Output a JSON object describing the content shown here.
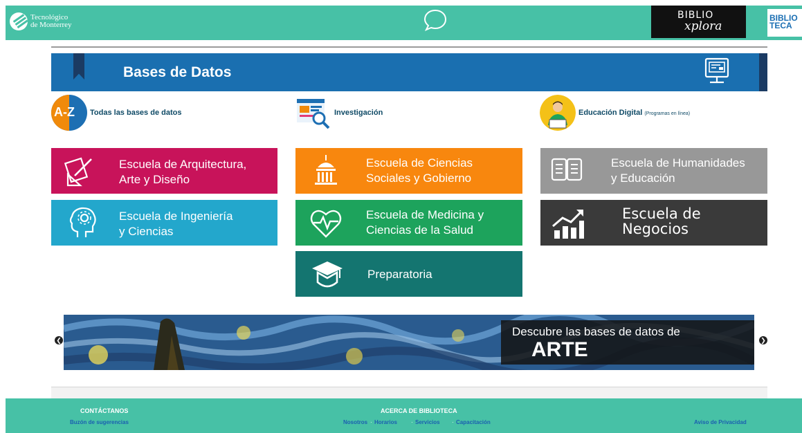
{
  "header": {
    "logo_line1": "Tecnológico",
    "logo_line2": "de Monterrey",
    "biblioxplora_top": "BIBLIO",
    "biblioxplora_bottom": "xplora",
    "biblioteca_line1": "BIBLIO",
    "biblioteca_line2": "TECA"
  },
  "banner": {
    "title": "Bases de Datos"
  },
  "categories": [
    {
      "icon_text": "A-Z",
      "label": "Todas las bases de datos"
    },
    {
      "label": "Investigación"
    },
    {
      "label": "Educación Digital",
      "sublabel": "(Programas en línea)"
    }
  ],
  "schools": [
    {
      "line1": "Escuela de Arquitectura,",
      "line2": "Arte y Diseño",
      "color": "#c8135a"
    },
    {
      "line1": "Escuela de Ciencias",
      "line2": "Sociales y Gobierno",
      "color": "#f8870e"
    },
    {
      "line1": "Escuela de Humanidades",
      "line2": "y Educación",
      "color": "#989898"
    },
    {
      "line1": "Escuela de Ingeniería",
      "line2": "y Ciencias",
      "color": "#23a7cc"
    },
    {
      "line1": "Escuela de Medicina y",
      "line2": "Ciencias de la Salud",
      "color": "#1da35c"
    },
    {
      "line1": "Escuela de",
      "line2": "Negocios",
      "color": "#3a3a3a"
    },
    {
      "line1": "Preparatoria",
      "color": "#147570"
    }
  ],
  "carousel": {
    "caption_line1": "Descubre las bases de datos de",
    "caption_line2": "ARTE"
  },
  "footer": {
    "contact_title": "CONTÁCTANOS",
    "contact_link": "Buzón de sugerencias",
    "about_title": "ACERCA DE BIBLIOTECA",
    "about_links": [
      "Nosotros",
      "Horarios",
      "Servicios",
      "Capacitación"
    ],
    "privacy": "Aviso de Privacidad"
  },
  "colors": {
    "brand_green": "#47c1a6",
    "banner_blue": "#1a6fb0",
    "link_blue": "#1a5fb0"
  }
}
